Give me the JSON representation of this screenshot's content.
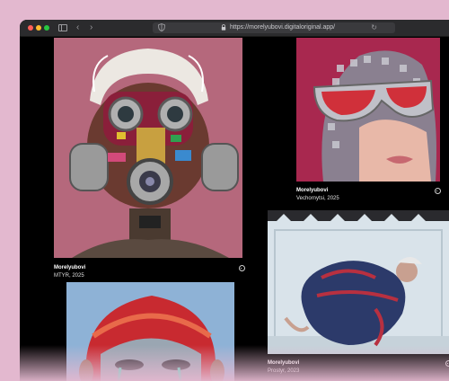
{
  "browser": {
    "url": "https://morelyubovi.digitaloriginal.app/"
  },
  "gallery": {
    "cards": [
      {
        "artist": "Morelyubovi",
        "subtitle": "MTYR, 2025"
      },
      {
        "artist": "Morelyubovi",
        "subtitle": "Vechornytsi, 2025"
      },
      {
        "artist": "Morelyubovi",
        "subtitle": "Prostyr, 2023"
      }
    ]
  },
  "colors": {
    "page_background": "#e3b8cf",
    "window_background": "#000000",
    "titlebar": "#2b2b2d"
  },
  "icons": [
    "sidebar-toggle-icon",
    "back-arrow-icon",
    "forward-arrow-icon",
    "shield-icon",
    "lock-icon",
    "reload-icon",
    "more-options-icon"
  ]
}
